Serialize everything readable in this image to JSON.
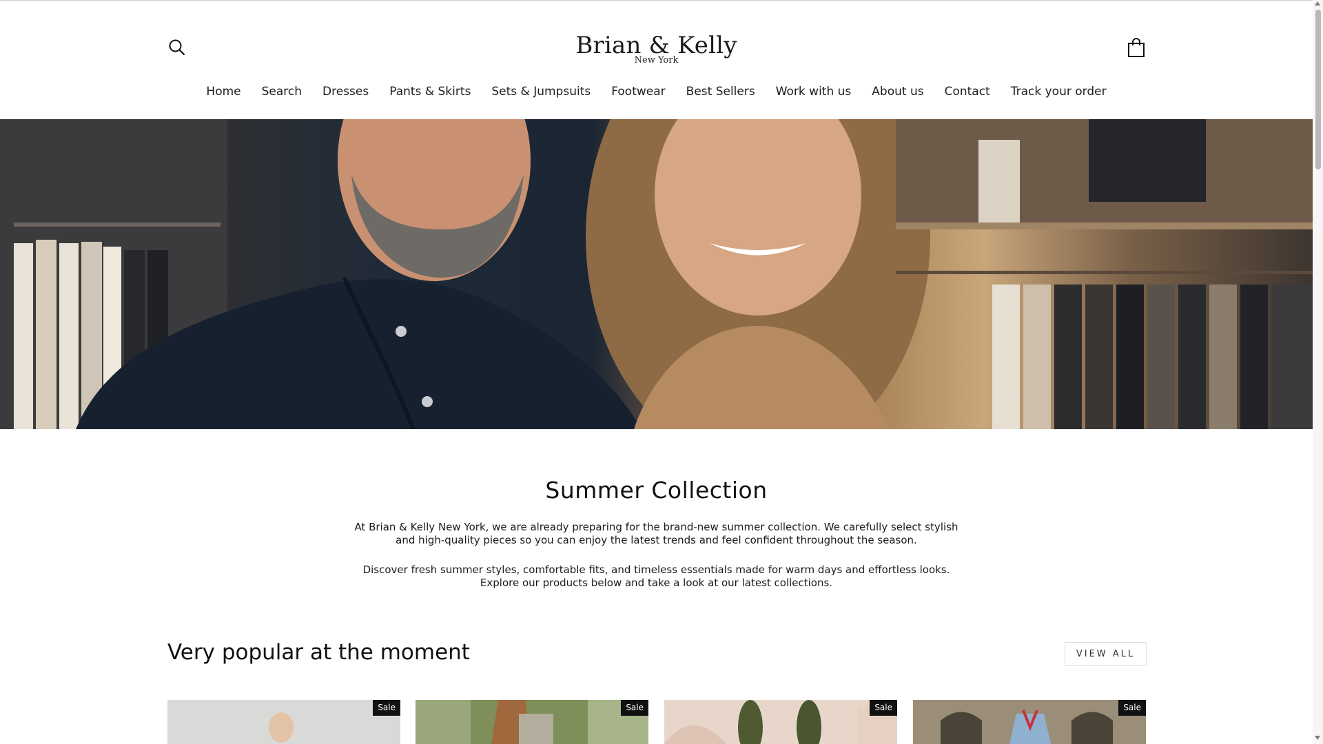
{
  "header": {
    "logo_main": "Brian & Kelly",
    "logo_sub": "New York"
  },
  "nav": {
    "items": [
      {
        "label": "Home"
      },
      {
        "label": "Search"
      },
      {
        "label": "Dresses"
      },
      {
        "label": "Pants & Skirts"
      },
      {
        "label": "Sets & Jumpsuits"
      },
      {
        "label": "Footwear"
      },
      {
        "label": "Best Sellers"
      },
      {
        "label": "Work with us"
      },
      {
        "label": "About us"
      },
      {
        "label": "Contact"
      },
      {
        "label": "Track your order"
      }
    ]
  },
  "intro": {
    "title": "Summer Collection",
    "paragraph1": "At Brian & Kelly New York, we are already preparing for the brand-new summer collection. We carefully select stylish and high-quality pieces so you can enjoy the latest trends and feel confident throughout the season.",
    "paragraph2": "Discover fresh summer styles, comfortable fits, and timeless essentials made for warm days and effortless looks. Explore our products below and take a look at our latest collections."
  },
  "popular": {
    "title": "Very popular at the moment",
    "view_all": "VIEW ALL",
    "products": [
      {
        "badge": "Sale"
      },
      {
        "badge": "Sale"
      },
      {
        "badge": "Sale"
      },
      {
        "badge": "Sale"
      }
    ]
  },
  "icons": {
    "search": "search-icon",
    "cart": "shopping-bag-icon"
  },
  "colors": {
    "text": "#111111",
    "badge_bg": "#111111",
    "badge_text": "#ffffff"
  }
}
